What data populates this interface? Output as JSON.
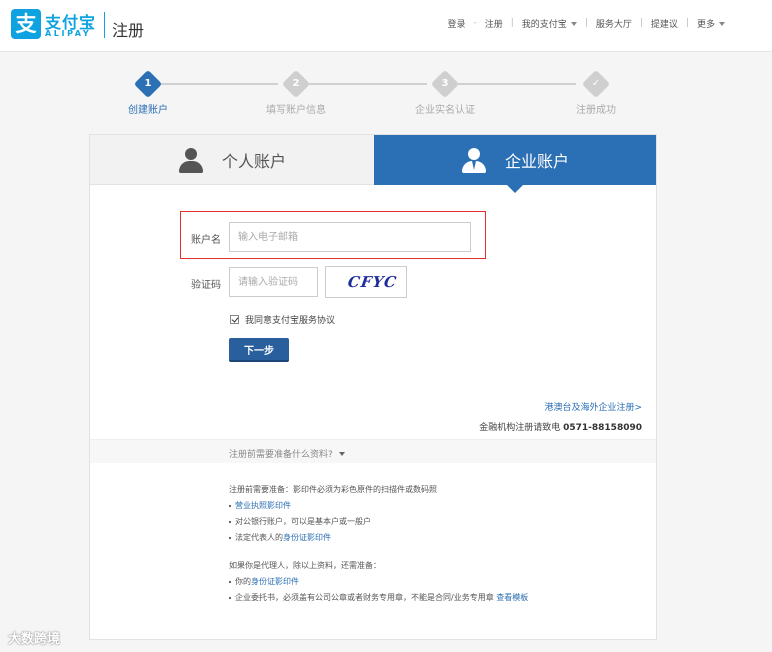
{
  "header": {
    "logo_mark": "支",
    "logo_cn": "支付宝",
    "logo_en": "ALIPAY",
    "page_title": "注册",
    "nav": {
      "login": "登录",
      "register": "注册",
      "my_alipay": "我的支付宝",
      "service_hall": "服务大厅",
      "feedback": "提建议",
      "more": "更多"
    }
  },
  "steps": [
    {
      "number": "1",
      "label": "创建账户",
      "active": true
    },
    {
      "number": "2",
      "label": "填写账户信息",
      "active": false
    },
    {
      "number": "3",
      "label": "企业实名认证",
      "active": false
    },
    {
      "number": "✓",
      "label": "注册成功",
      "active": false
    }
  ],
  "tabs": {
    "personal": "个人账户",
    "business": "企业账户",
    "selected": "business"
  },
  "form": {
    "account_label": "账户名",
    "account_placeholder": "输入电子邮箱",
    "captcha_label": "验证码",
    "captcha_placeholder": "请输入验证码",
    "captcha_text": "CFYC",
    "agree_text": "我同意支付宝服务协议",
    "agree_checked": true,
    "next_button": "下一步"
  },
  "links": {
    "hk_register": "港澳台及海外企业注册>",
    "phone_prefix": "金融机构注册请致电",
    "phone_number": "0571-88158090"
  },
  "preparation": {
    "toggle_label": "注册前需要准备什么资料?",
    "intro": "注册前需要准备：影印件必须为彩色原件的扫描件或数码照",
    "items": [
      {
        "prefix": "",
        "link": "营业执照影印件",
        "suffix": ""
      },
      {
        "prefix": "对公银行账户，可以是基本户或一般户",
        "link": "",
        "suffix": ""
      },
      {
        "prefix": "法定代表人的",
        "link": "身份证影印件",
        "suffix": ""
      }
    ],
    "agent_intro": "如果你是代理人，除以上资料，还需准备：",
    "agent_items": [
      {
        "prefix": "你的",
        "link": "身份证影印件",
        "suffix": ""
      },
      {
        "prefix": "企业委托书，必须盖有公司公章或者财务专用章，不能是合同/业务专用章 ",
        "link": "查看模板",
        "suffix": ""
      }
    ]
  },
  "watermark": "大数跨境",
  "colors": {
    "brand_blue": "#0ea2e0",
    "tab_active": "#2b6fb4",
    "button": "#2a5f9e",
    "highlight_red": "#e0302b"
  }
}
